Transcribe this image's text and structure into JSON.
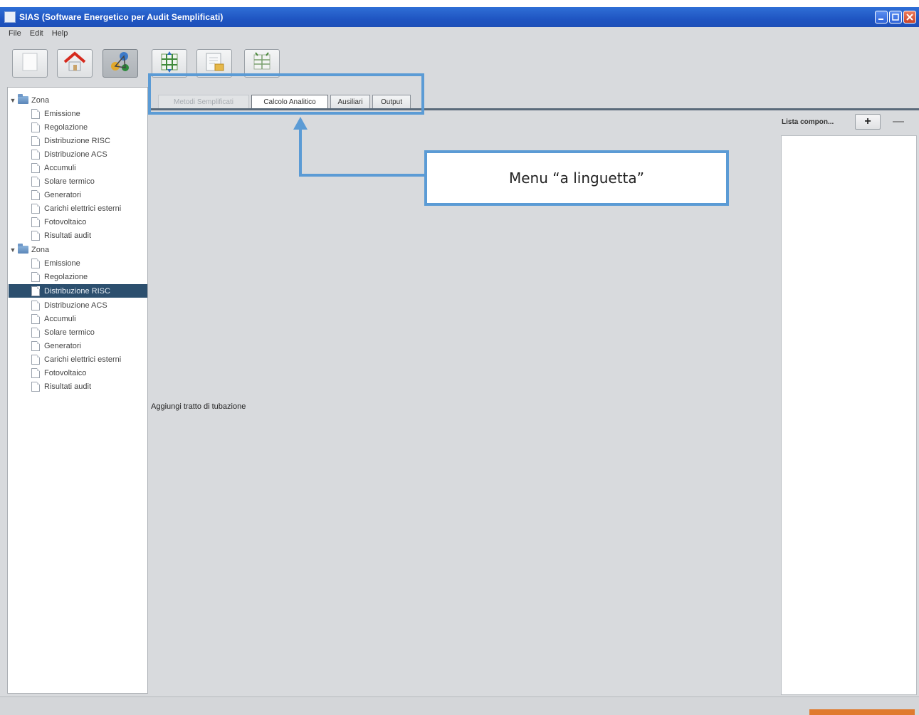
{
  "window": {
    "title": "SIAS (Software Energetico per Audit Semplificati)",
    "controls": [
      "minimize-icon",
      "maximize-icon",
      "close-icon"
    ]
  },
  "menubar": {
    "items": [
      "File",
      "Edit",
      "Help"
    ]
  },
  "toolbar": {
    "buttons": [
      {
        "icon": "blank-document-icon",
        "pressed": false
      },
      {
        "icon": "home-icon",
        "pressed": false
      },
      {
        "icon": "network-nodes-icon",
        "pressed": true
      },
      {
        "icon": "grid-arrows-icon",
        "pressed": false
      },
      {
        "icon": "export-document-icon",
        "pressed": false
      },
      {
        "icon": "table-arrows-icon",
        "pressed": false
      }
    ]
  },
  "tree": {
    "groups": [
      {
        "label": "Zona",
        "children": [
          "Emissione",
          "Regolazione",
          "Distribuzione RISC",
          "Distribuzione ACS",
          "Accumuli",
          "Solare termico",
          "Generatori",
          "Carichi elettrici esterni",
          "Fotovoltaico",
          "Risultati audit"
        ]
      },
      {
        "label": "Zona",
        "children": [
          "Emissione",
          "Regolazione",
          "Distribuzione RISC",
          "Distribuzione ACS",
          "Accumuli",
          "Solare termico",
          "Generatori",
          "Carichi elettrici esterni",
          "Fotovoltaico",
          "Risultati audit"
        ]
      }
    ],
    "selected": "Distribuzione RISC"
  },
  "tabs": [
    {
      "label": "Metodi Semplificati",
      "state": "disabled"
    },
    {
      "label": "Calcolo Analitico",
      "state": "active"
    },
    {
      "label": "Ausiliari",
      "state": "normal"
    },
    {
      "label": "Output",
      "state": "normal"
    }
  ],
  "content": {
    "label": "Aggiungi tratto di tubazione"
  },
  "right_panel": {
    "title": "Lista compon...",
    "add_label": "+",
    "remove_label": "—"
  },
  "annotation": {
    "callout_text": "Menu “a linguetta”",
    "color": "#5b9bd5"
  },
  "colors": {
    "titlebar": "#1f55c2",
    "selection": "#2c4f6e",
    "progress": "#e07a2e"
  }
}
